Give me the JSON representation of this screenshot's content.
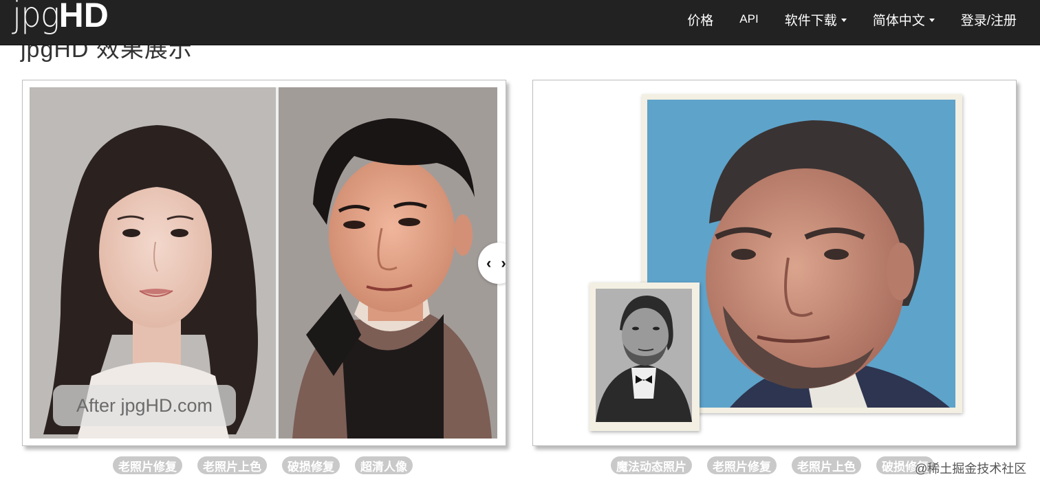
{
  "header": {
    "logo_light": "jpg",
    "logo_bold": "HD",
    "nav": [
      {
        "label": "价格"
      },
      {
        "label": "API"
      },
      {
        "label": "软件下载"
      },
      {
        "label": "简体中文"
      },
      {
        "label": "登录/注册"
      }
    ]
  },
  "section": {
    "title": "jpgHD 效果展示"
  },
  "left_card": {
    "watermark": "After jpgHD.com",
    "slider_left": "‹",
    "slider_right": "›",
    "tags": [
      "老照片修复",
      "老照片上色",
      "破损修复",
      "超清人像"
    ]
  },
  "right_card": {
    "tags": [
      "魔法动态照片",
      "老照片修复",
      "老照片上色",
      "破损修复"
    ]
  },
  "corner_watermark": "@稀土掘金技术社区",
  "colors": {
    "navbar_bg": "#222222",
    "tag_bg": "#c9c9c9",
    "portrait_bg_blue": "#5aa0c8"
  }
}
